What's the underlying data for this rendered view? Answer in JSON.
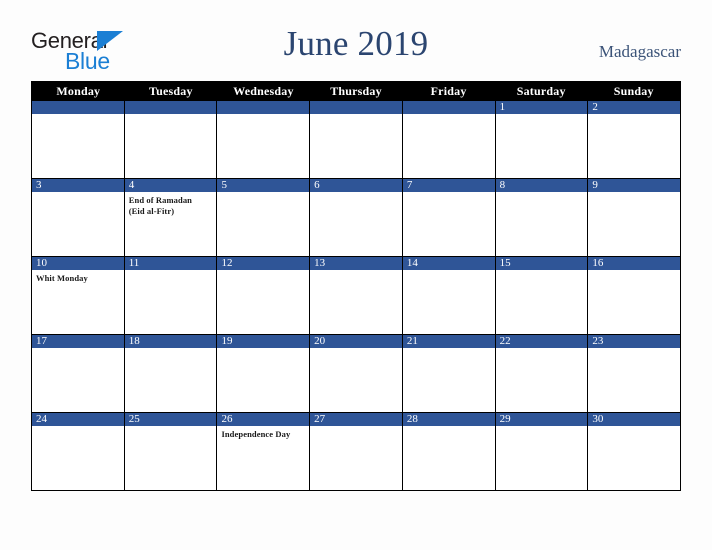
{
  "brand": {
    "logo_general": "General",
    "logo_blue": "Blue",
    "logo_triangle_icon": "triangle-icon",
    "accent_color": "#1b7fd4"
  },
  "header": {
    "title": "June 2019",
    "country": "Madagascar",
    "title_color": "#2b4570"
  },
  "calendar": {
    "day_headers": [
      "Monday",
      "Tuesday",
      "Wednesday",
      "Thursday",
      "Friday",
      "Saturday",
      "Sunday"
    ],
    "header_bg": "#000000",
    "daynum_bg": "#2f5597",
    "weeks": [
      [
        {
          "day": "",
          "events": []
        },
        {
          "day": "",
          "events": []
        },
        {
          "day": "",
          "events": []
        },
        {
          "day": "",
          "events": []
        },
        {
          "day": "",
          "events": []
        },
        {
          "day": "1",
          "events": []
        },
        {
          "day": "2",
          "events": []
        }
      ],
      [
        {
          "day": "3",
          "events": []
        },
        {
          "day": "4",
          "events": [
            "End of Ramadan",
            "(Eid al-Fitr)"
          ]
        },
        {
          "day": "5",
          "events": []
        },
        {
          "day": "6",
          "events": []
        },
        {
          "day": "7",
          "events": []
        },
        {
          "day": "8",
          "events": []
        },
        {
          "day": "9",
          "events": []
        }
      ],
      [
        {
          "day": "10",
          "events": [
            "Whit Monday"
          ]
        },
        {
          "day": "11",
          "events": []
        },
        {
          "day": "12",
          "events": []
        },
        {
          "day": "13",
          "events": []
        },
        {
          "day": "14",
          "events": []
        },
        {
          "day": "15",
          "events": []
        },
        {
          "day": "16",
          "events": []
        }
      ],
      [
        {
          "day": "17",
          "events": []
        },
        {
          "day": "18",
          "events": []
        },
        {
          "day": "19",
          "events": []
        },
        {
          "day": "20",
          "events": []
        },
        {
          "day": "21",
          "events": []
        },
        {
          "day": "22",
          "events": []
        },
        {
          "day": "23",
          "events": []
        }
      ],
      [
        {
          "day": "24",
          "events": []
        },
        {
          "day": "25",
          "events": []
        },
        {
          "day": "26",
          "events": [
            "Independence Day"
          ]
        },
        {
          "day": "27",
          "events": []
        },
        {
          "day": "28",
          "events": []
        },
        {
          "day": "29",
          "events": []
        },
        {
          "day": "30",
          "events": []
        }
      ]
    ]
  }
}
